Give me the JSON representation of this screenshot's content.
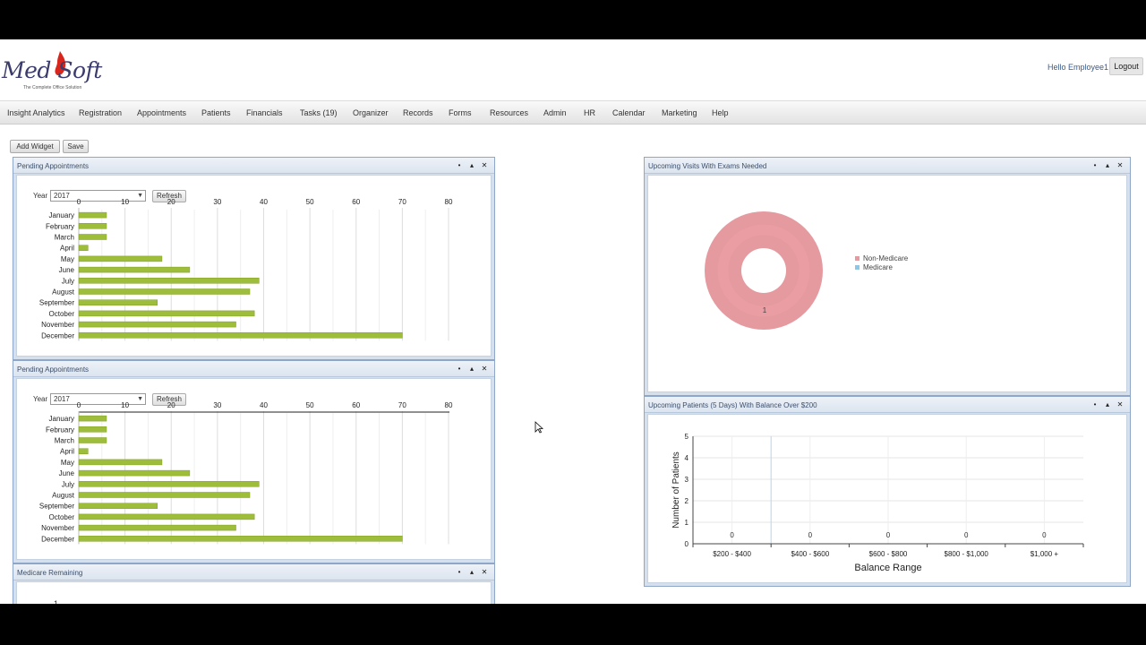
{
  "brand": {
    "logo_text": "Med Soft",
    "tagline": "The Complete Office Solution"
  },
  "user": {
    "greeting": "Hello Employee1",
    "logout_label": "Logout"
  },
  "nav": [
    "Insight Analytics",
    "Registration",
    "Appointments",
    "Patients",
    "Financials",
    "Tasks (19)",
    "Organizer",
    "Records",
    "Forms",
    "Resources",
    "Admin",
    "HR",
    "Calendar",
    "Marketing",
    "Help"
  ],
  "toolbar": {
    "add_widget": "Add Widget",
    "save": "Save"
  },
  "widgets": {
    "pending1": {
      "title": "Pending Appointments",
      "year_label": "Year",
      "year_value": "2017",
      "refresh": "Refresh"
    },
    "pending2": {
      "title": "Pending Appointments",
      "year_label": "Year",
      "year_value": "2017",
      "refresh": "Refresh"
    },
    "medicare": {
      "title": "Medicare Remaining",
      "tick_visible": "1"
    },
    "visits": {
      "title": "Upcoming Visits With Exams Needed"
    },
    "balance": {
      "title": "Upcoming Patients (5 Days) With Balance Over $200"
    }
  },
  "window_controls": {
    "minimize": "•",
    "maximize": "▴",
    "close": "✕"
  },
  "colors": {
    "bar": "#9ebd3a",
    "donut": "#e59aa0",
    "medicare": "#8ec7e6",
    "widget_border": "#8ea7c8"
  },
  "chart_data": [
    {
      "type": "bar",
      "orientation": "horizontal",
      "title": "Pending Appointments",
      "categories": [
        "January",
        "February",
        "March",
        "April",
        "May",
        "June",
        "July",
        "August",
        "September",
        "October",
        "November",
        "December"
      ],
      "values": [
        6,
        6,
        6,
        2,
        18,
        24,
        39,
        37,
        17,
        38,
        34,
        70
      ],
      "xticks": [
        "0",
        "10",
        "20",
        "30",
        "40",
        "50",
        "60",
        "70",
        "80"
      ],
      "xlim": [
        0,
        80
      ]
    },
    {
      "type": "bar",
      "orientation": "horizontal",
      "title": "Pending Appointments",
      "categories": [
        "January",
        "February",
        "March",
        "April",
        "May",
        "June",
        "July",
        "August",
        "September",
        "October",
        "November",
        "December"
      ],
      "values": [
        6,
        6,
        6,
        2,
        18,
        24,
        39,
        37,
        17,
        38,
        34,
        70
      ],
      "xticks": [
        "0",
        "10",
        "20",
        "30",
        "40",
        "50",
        "60",
        "70",
        "80"
      ],
      "xlim": [
        0,
        80
      ]
    },
    {
      "type": "pie",
      "style": "donut",
      "title": "Upcoming Visits With Exams Needed",
      "series": [
        {
          "name": "Non-Medicare",
          "value": 1
        },
        {
          "name": "Medicare",
          "value": 0
        }
      ],
      "slice_label": "1",
      "legend": "right"
    },
    {
      "type": "bar",
      "title": "Upcoming Patients (5 Days) With Balance Over $200",
      "categories": [
        "$200 - $400",
        "$400 - $600",
        "$600 - $800",
        "$800 - $1,000",
        "$1,000 +"
      ],
      "values": [
        0,
        0,
        0,
        0,
        0
      ],
      "xlabel": "Balance Range",
      "ylabel": "Number of Patients",
      "ylim": [
        0,
        5
      ],
      "yticks": [
        "0",
        "1",
        "2",
        "3",
        "4",
        "5"
      ]
    }
  ]
}
